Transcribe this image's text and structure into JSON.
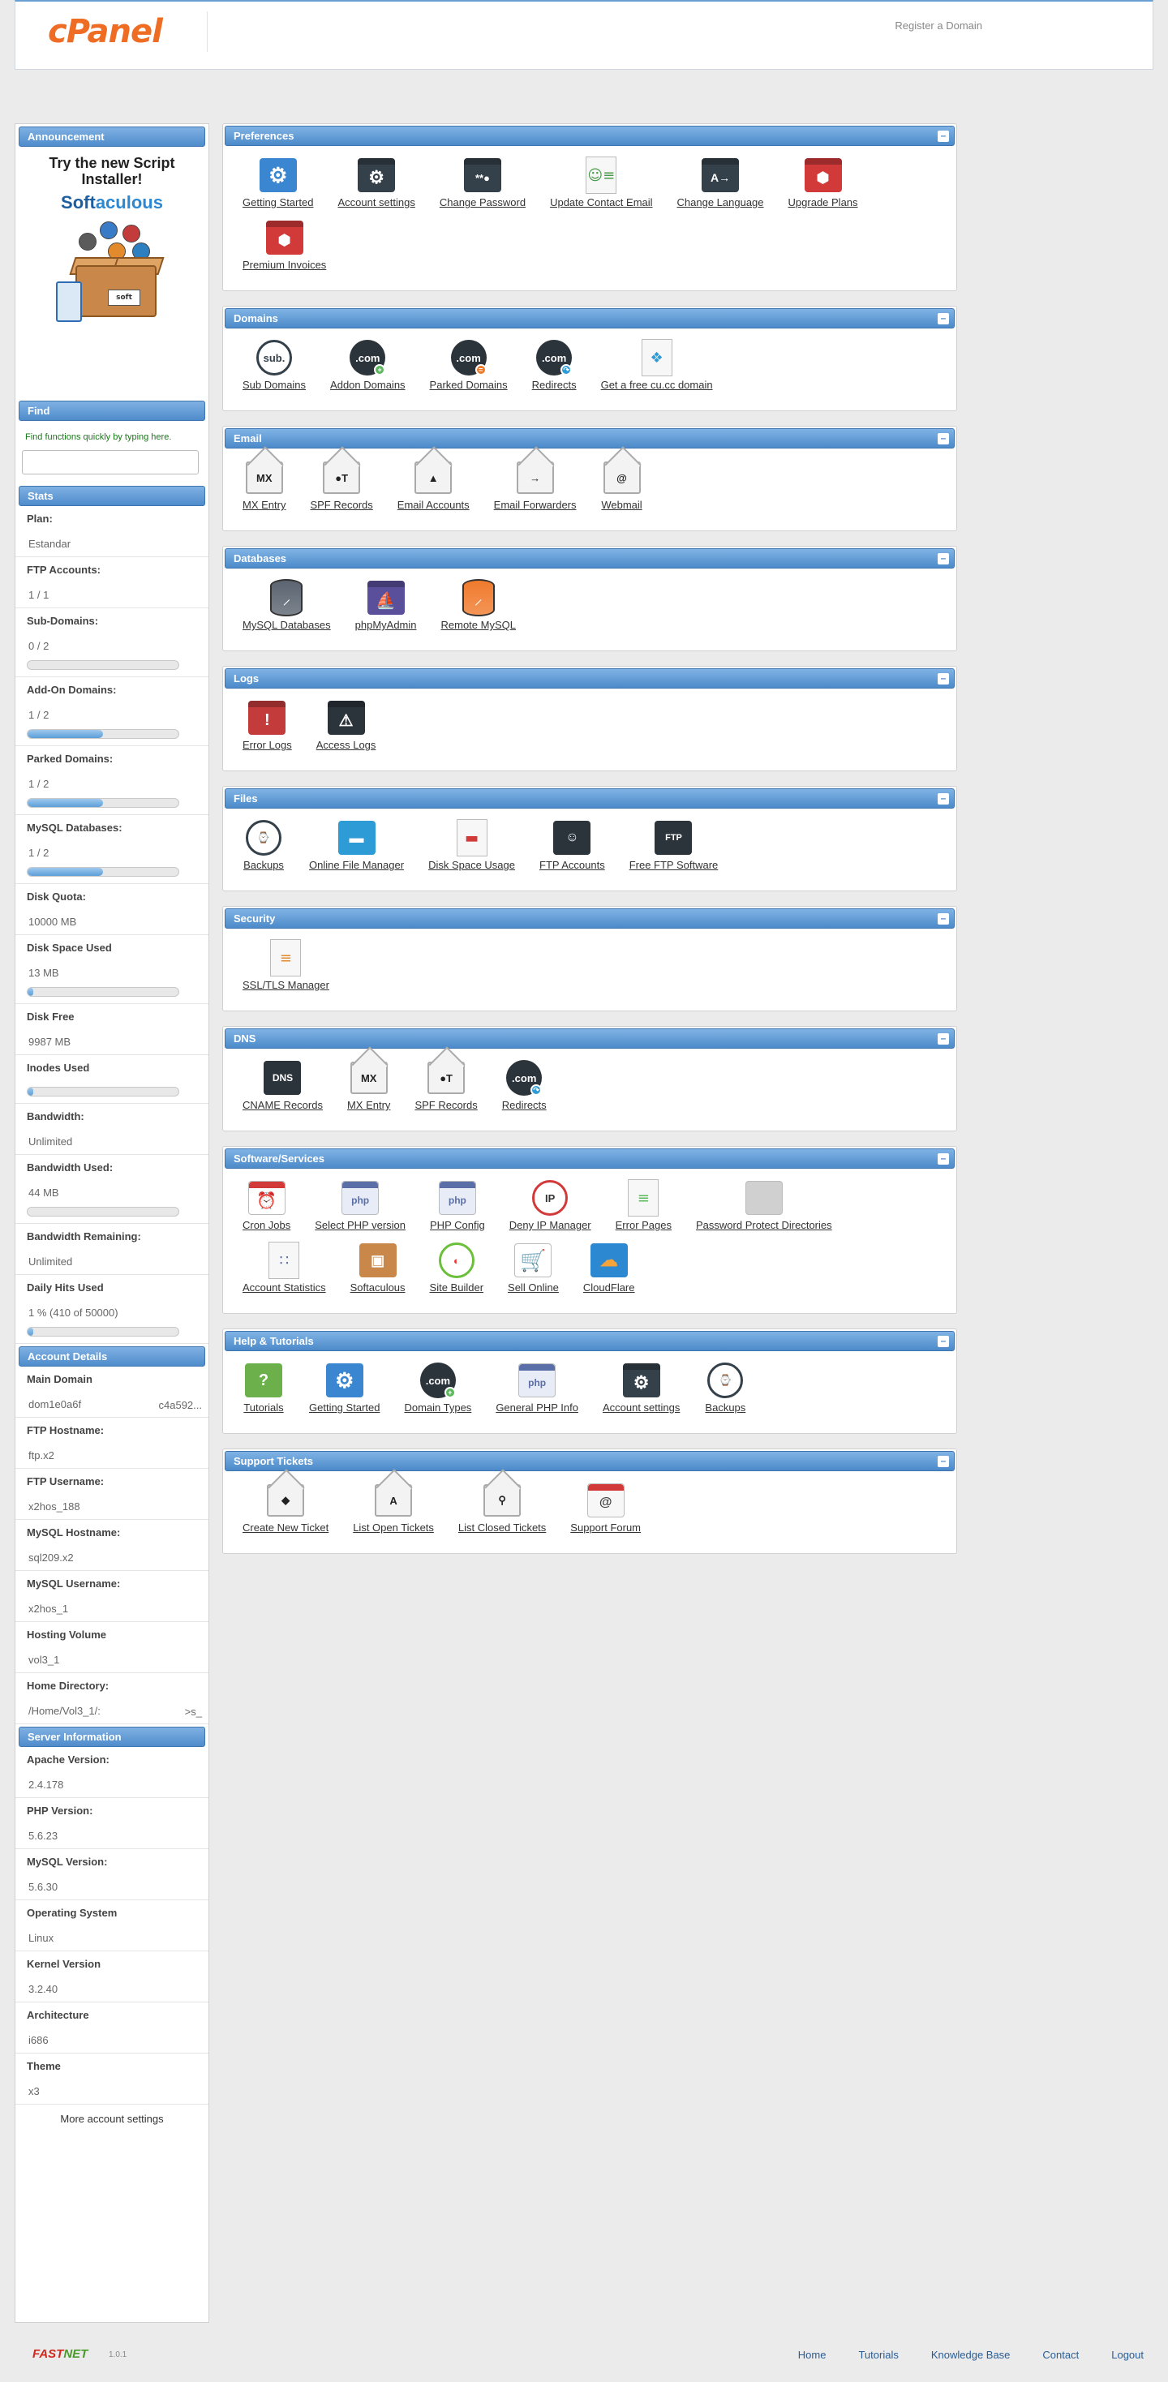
{
  "header": {
    "logo": "cPanel",
    "register_link": "Register a Domain"
  },
  "sidebar": {
    "announcement": {
      "title": "Announcement",
      "line1": "Try the new Script Installer!",
      "brand_a": "Soft",
      "brand_b": "aculous",
      "box_label": "soft"
    },
    "find": {
      "title": "Find",
      "hint": "Find functions quickly by typing here.",
      "placeholder": ""
    },
    "stats": {
      "title": "Stats",
      "items": [
        {
          "label": "Plan:",
          "value": "Estandar"
        },
        {
          "label": "FTP Accounts:",
          "value": "1 / 1"
        },
        {
          "label": "Sub-Domains:",
          "value": "0 / 2",
          "fill": 0
        },
        {
          "label": "Add-On Domains:",
          "value": "1 / 2",
          "fill": 0.5
        },
        {
          "label": "Parked Domains:",
          "value": "1 / 2",
          "fill": 0.5
        },
        {
          "label": "MySQL Databases:",
          "value": "1 / 2",
          "fill": 0.5
        },
        {
          "label": "Disk Quota:",
          "value": "10000 MB"
        },
        {
          "label": "Disk Space Used",
          "value": "13 MB",
          "fill": 0.001
        },
        {
          "label": "Disk Free",
          "value": "9987 MB"
        },
        {
          "label": "Inodes Used",
          "value": "",
          "fill": 0.03
        },
        {
          "label": "Bandwidth:",
          "value": "Unlimited"
        },
        {
          "label": "Bandwidth Used:",
          "value": "44 MB",
          "fill": 0
        },
        {
          "label": "Bandwidth Remaining:",
          "value": "Unlimited"
        },
        {
          "label": "Daily Hits Used",
          "value": "1 % (410 of 50000)",
          "fill": 0.01
        }
      ]
    },
    "account": {
      "title": "Account Details",
      "items": [
        {
          "label": "Main Domain",
          "value": "dom1e0a6f",
          "side": "c4a592..."
        },
        {
          "label": "FTP Hostname:",
          "value": "ftp.x2"
        },
        {
          "label": "FTP Username:",
          "value": "x2hos_188"
        },
        {
          "label": "MySQL Hostname:",
          "value": "sql209.x2"
        },
        {
          "label": "MySQL Username:",
          "value": "x2hos_1"
        },
        {
          "label": "Hosting Volume",
          "value": "vol3_1"
        },
        {
          "label": "Home Directory:",
          "value": "/Home/Vol3_1/:",
          "side": ">s_"
        }
      ]
    },
    "server": {
      "title": "Server Information",
      "items": [
        {
          "label": "Apache Version:",
          "value": "2.4.178"
        },
        {
          "label": "PHP Version:",
          "value": "5.6.23"
        },
        {
          "label": "MySQL Version:",
          "value": "5.6.30"
        },
        {
          "label": "Operating System",
          "value": "Linux"
        },
        {
          "label": "Kernel Version",
          "value": "3.2.40"
        },
        {
          "label": "Architecture",
          "value": "i686"
        },
        {
          "label": "Theme",
          "value": "x3"
        }
      ]
    },
    "more_settings": "More account settings"
  },
  "panels": [
    {
      "title": "Preferences",
      "items": [
        {
          "label": "Getting Started",
          "icon": "gear-puzzle-icon"
        },
        {
          "label": "Account settings",
          "icon": "settings-icon"
        },
        {
          "label": "Change Password",
          "icon": "password-icon"
        },
        {
          "label": "Update Contact Email",
          "icon": "contact-icon"
        },
        {
          "label": "Change Language",
          "icon": "language-icon"
        },
        {
          "label": "Upgrade Plans",
          "icon": "upgrade-icon"
        },
        {
          "label": "Premium Invoices",
          "icon": "invoice-icon"
        }
      ]
    },
    {
      "title": "Domains",
      "items": [
        {
          "label": "Sub Domains",
          "icon": "subdomain-icon",
          "text": "sub."
        },
        {
          "label": "Addon Domains",
          "icon": "addon-domain-icon",
          "text": ".com"
        },
        {
          "label": "Parked Domains",
          "icon": "parked-domain-icon",
          "text": ".com"
        },
        {
          "label": "Redirects",
          "icon": "redirect-icon",
          "text": ".com"
        },
        {
          "label": "Get a free cu.cc domain",
          "icon": "puzzle-icon"
        }
      ]
    },
    {
      "title": "Email",
      "items": [
        {
          "label": "MX Entry",
          "icon": "mx-envelope-icon",
          "text": "MX"
        },
        {
          "label": "SPF Records",
          "icon": "spf-envelope-icon",
          "text": "●T"
        },
        {
          "label": "Email Accounts",
          "icon": "email-account-icon",
          "text": "▲"
        },
        {
          "label": "Email Forwarders",
          "icon": "forwarder-icon",
          "text": "→"
        },
        {
          "label": "Webmail",
          "icon": "webmail-icon",
          "text": "@"
        }
      ]
    },
    {
      "title": "Databases",
      "items": [
        {
          "label": "MySQL Databases",
          "icon": "mysql-icon"
        },
        {
          "label": "phpMyAdmin",
          "icon": "phpmyadmin-icon"
        },
        {
          "label": "Remote MySQL",
          "icon": "remote-mysql-icon"
        }
      ]
    },
    {
      "title": "Logs",
      "items": [
        {
          "label": "Error Logs",
          "icon": "error-log-icon"
        },
        {
          "label": "Access Logs",
          "icon": "access-log-icon"
        }
      ]
    },
    {
      "title": "Files",
      "items": [
        {
          "label": "Backups",
          "icon": "backup-icon"
        },
        {
          "label": "Online File Manager",
          "icon": "file-manager-icon"
        },
        {
          "label": "Disk Space Usage",
          "icon": "disk-usage-icon"
        },
        {
          "label": "FTP Accounts",
          "icon": "ftp-account-icon"
        },
        {
          "label": "Free FTP Software",
          "icon": "ftp-software-icon",
          "text": "FTP"
        }
      ]
    },
    {
      "title": "Security",
      "items": [
        {
          "label": "SSL/TLS Manager",
          "icon": "ssl-icon"
        }
      ]
    },
    {
      "title": "DNS",
      "items": [
        {
          "label": "CNAME Records",
          "icon": "cname-icon",
          "text": "DNS"
        },
        {
          "label": "MX Entry",
          "icon": "mx-envelope-icon",
          "text": "MX"
        },
        {
          "label": "SPF Records",
          "icon": "spf-envelope-icon",
          "text": "●T"
        },
        {
          "label": "Redirects",
          "icon": "redirect-icon",
          "text": ".com"
        }
      ]
    },
    {
      "title": "Software/Services",
      "items": [
        {
          "label": "Cron Jobs",
          "icon": "cron-icon"
        },
        {
          "label": "Select PHP version",
          "icon": "php-version-icon",
          "text": "php"
        },
        {
          "label": "PHP Config",
          "icon": "php-config-icon",
          "text": "php"
        },
        {
          "label": "Deny IP Manager",
          "icon": "deny-ip-icon",
          "text": "IP"
        },
        {
          "label": "Error Pages",
          "icon": "error-page-icon"
        },
        {
          "label": "Password Protect Directories",
          "icon": "folder-lock-icon"
        },
        {
          "label": "Account Statistics",
          "icon": "statistics-icon"
        },
        {
          "label": "Softaculous",
          "icon": "softaculous-icon"
        },
        {
          "label": "Site Builder",
          "icon": "site-builder-icon"
        },
        {
          "label": "Sell Online",
          "icon": "cart-icon"
        },
        {
          "label": "CloudFlare",
          "icon": "cloudflare-icon"
        }
      ]
    },
    {
      "title": "Help & Tutorials",
      "items": [
        {
          "label": "Tutorials",
          "icon": "tutorial-icon",
          "text": "?"
        },
        {
          "label": "Getting Started",
          "icon": "gear-puzzle-icon"
        },
        {
          "label": "Domain Types",
          "icon": "domain-type-icon",
          "text": ".com"
        },
        {
          "label": "General PHP Info",
          "icon": "php-info-icon",
          "text": "php"
        },
        {
          "label": "Account settings",
          "icon": "settings-icon"
        },
        {
          "label": "Backups",
          "icon": "backup-icon"
        }
      ]
    },
    {
      "title": "Support Tickets",
      "items": [
        {
          "label": "Create New Ticket",
          "icon": "new-ticket-icon"
        },
        {
          "label": "List Open Tickets",
          "icon": "open-ticket-icon",
          "text": "A"
        },
        {
          "label": "List Closed Tickets",
          "icon": "closed-ticket-icon"
        },
        {
          "label": "Support Forum",
          "icon": "forum-icon",
          "text": "@"
        }
      ]
    }
  ],
  "footer": {
    "brand_a": "FAST",
    "brand_b": "NET",
    "version": "1.0.1",
    "links": [
      "Home",
      "Tutorials",
      "Knowledge Base",
      "Contact",
      "Logout"
    ]
  },
  "colors": {
    "accent": "#4f8ccb",
    "brand": "#ee6c23",
    "page_bg": "#ebebeb"
  }
}
